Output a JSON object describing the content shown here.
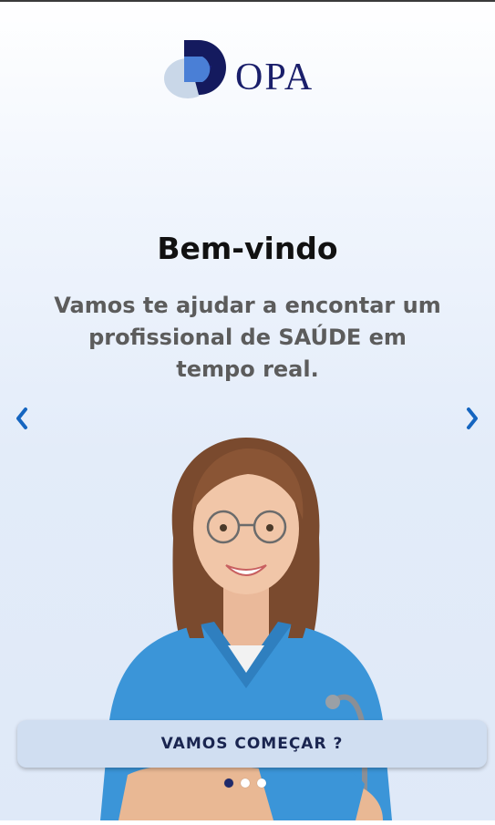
{
  "app": {
    "logo_text": "OPA",
    "brand_colors": {
      "primary": "#1a1f6b",
      "accent": "#4a7fd6",
      "light": "#c9d7e8"
    }
  },
  "onboarding": {
    "title": "Bem-vindo",
    "subtitle": "Vamos te ajudar a encontar um profissional de SAÚDE em tempo real.",
    "prev_icon": "chevron-left-icon",
    "next_icon": "chevron-right-icon",
    "cta_label": "VAMOS COMEÇAR ?",
    "pagination": {
      "total": 3,
      "current": 1
    }
  }
}
